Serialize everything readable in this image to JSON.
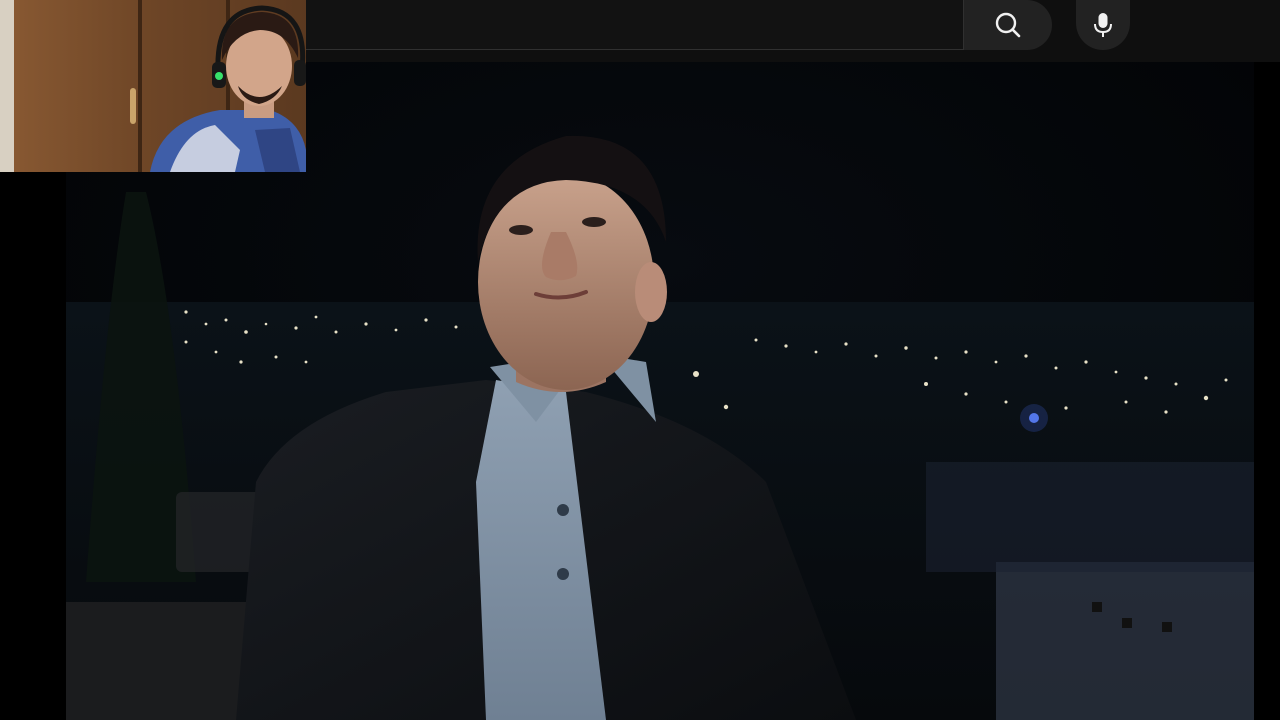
{
  "header": {
    "search": {
      "value": "",
      "placeholder": ""
    },
    "search_button": {
      "icon": "search-icon"
    },
    "mic_button": {
      "icon": "microphone-icon"
    }
  },
  "video": {
    "description": "",
    "colors": {
      "background": "#000000",
      "topbar": "#0f0f0f",
      "button": "#222222"
    }
  },
  "webcam": {
    "icon": "webcam-feed"
  }
}
